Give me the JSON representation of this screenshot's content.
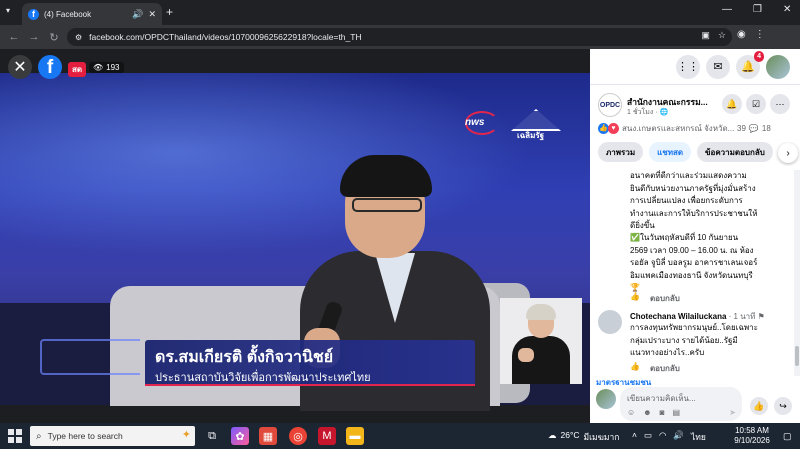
{
  "browser": {
    "tab_title": "(4) Facebook",
    "url": "facebook.com/OPDCThailand/videos/1070009625622918?locale=th_TH",
    "new_tab": "+"
  },
  "video": {
    "live_label": "สด",
    "viewers": "193",
    "speaker_name": "ดร.สมเกียรติ ตั้งกิจวานิชย์",
    "speaker_title": "ประธานสถาบันวิจัยเพื่อการพัฒนาประเทศไทย",
    "logo_text": "nws",
    "crest_text": "เฉลิมรัฐ"
  },
  "panel": {
    "notifications_count": "4",
    "page_name": "สำนักงานคณะกรรม...",
    "post_time": "1 ชั่วโมง ·",
    "reaction_names": "สนง.เกษตรและสหกรณ์ จังหวัด...",
    "reaction_count": "39",
    "comments_count": "18",
    "tabs": [
      {
        "label": "ภาพรวม"
      },
      {
        "label": "แชทสด"
      },
      {
        "label": "ข้อความตอบกลับ"
      }
    ],
    "comment1_text": "อนาคตที่ดีกว่าและร่วมแสดงความยินดีกับหน่วยงานภาครัฐที่มุ่งมั่นสร้างการเปลี่ยนแปลง เพื่อยกระดับการทำงานและการให้บริการประชาชนให้ดียิ่งขึ้น",
    "comment1_text2": "✅ในวันพฤหัสบดีที่ 10 กันยายน 2569 เวลา 09.00 – 16.00 น. ณ ห้องรอยัล จูบิลี่ บอลรูม อาคารชาเลนเจอร์ อิมแพคเมืองทองธานี จังหวัดนนทบุรี🏆",
    "reply_label": "ตอบกลับ",
    "comment2_author": "Chotechana Wilailuckana",
    "comment2_time": "· 1 นาที",
    "comment2_text": "การลงทุนทรัพยากรมนุษย์..โดยเฉพาะกลุ่มเปราะบาง รายได้น้อย..รัฐมีแนวทางอย่างไร..ครับ",
    "standard_label": "มาตรฐานชุมชน",
    "composer_placeholder": "เขียนความคิดเห็น..."
  },
  "taskbar": {
    "search_placeholder": "Type here to search",
    "temperature": "26°C",
    "weather_desc": "มีเมฆมาก",
    "language": "ไทย",
    "time": "10:58 AM",
    "date": "9/10/2026"
  }
}
